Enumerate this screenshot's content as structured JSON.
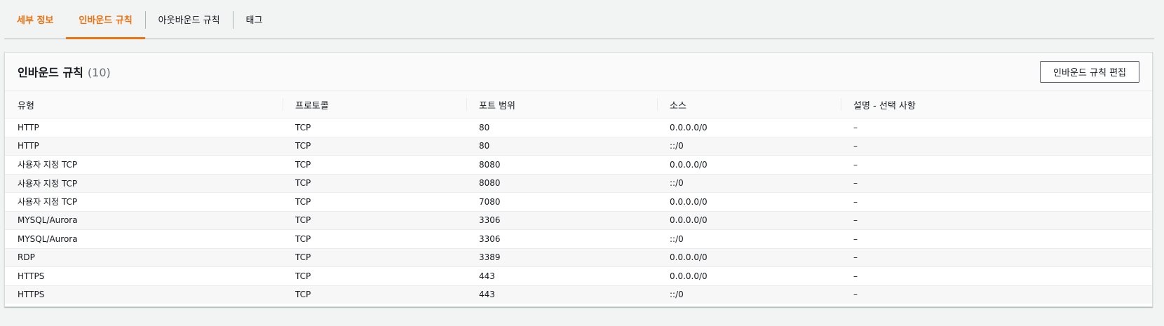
{
  "tabs": [
    {
      "label": "세부 정보"
    },
    {
      "label": "인바운드 규칙"
    },
    {
      "label": "아웃바운드 규칙"
    },
    {
      "label": "태그"
    }
  ],
  "panel": {
    "title": "인바운드 규칙",
    "count": "(10)",
    "edit_button": "인바운드 규칙 편집"
  },
  "table": {
    "headers": [
      "유형",
      "프로토콜",
      "포트 범위",
      "소스",
      "설명 - 선택 사항"
    ],
    "rows": [
      [
        "HTTP",
        "TCP",
        "80",
        "0.0.0.0/0",
        "–"
      ],
      [
        "HTTP",
        "TCP",
        "80",
        "::/0",
        "–"
      ],
      [
        "사용자 지정 TCP",
        "TCP",
        "8080",
        "0.0.0.0/0",
        "–"
      ],
      [
        "사용자 지정 TCP",
        "TCP",
        "8080",
        "::/0",
        "–"
      ],
      [
        "사용자 지정 TCP",
        "TCP",
        "7080",
        "0.0.0.0/0",
        "–"
      ],
      [
        "MYSQL/Aurora",
        "TCP",
        "3306",
        "0.0.0.0/0",
        "–"
      ],
      [
        "MYSQL/Aurora",
        "TCP",
        "3306",
        "::/0",
        "–"
      ],
      [
        "RDP",
        "TCP",
        "3389",
        "0.0.0.0/0",
        "–"
      ],
      [
        "HTTPS",
        "TCP",
        "443",
        "0.0.0.0/0",
        "–"
      ],
      [
        "HTTPS",
        "TCP",
        "443",
        "::/0",
        "–"
      ]
    ]
  },
  "colors": {
    "accent": "#ec7211"
  }
}
